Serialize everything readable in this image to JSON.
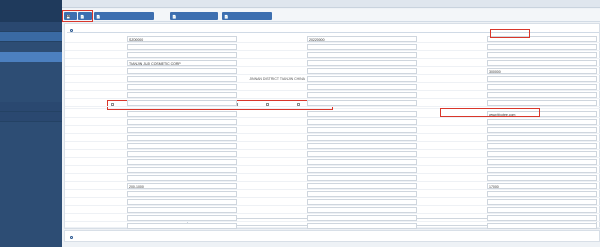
{
  "sidebar": {
    "brand": "",
    "groups": [
      {
        "label": "",
        "open": false
      },
      {
        "label": "",
        "open": true
      }
    ],
    "items": [
      {
        "label": ""
      },
      {
        "label": "",
        "active": true
      },
      {
        "label": ""
      },
      {
        "label": ""
      },
      {
        "label": ""
      },
      {
        "label": ""
      }
    ],
    "bottom_groups": [
      {
        "label": ""
      },
      {
        "label": ""
      }
    ]
  },
  "topbar": {
    "left": "",
    "right": ""
  },
  "toolbar": {
    "buttons": [
      {
        "label": ""
      },
      {
        "label": ""
      },
      {
        "label": ""
      },
      {
        "label": ""
      },
      {
        "label": ""
      }
    ]
  },
  "form": {
    "section_title": "",
    "rows": [
      {
        "l1": "",
        "v1": "SZ00000",
        "l2": "",
        "v2": "20220000",
        "l3": "",
        "v3": ""
      },
      {
        "l1": "",
        "v1": "",
        "l2": "",
        "v2": "",
        "l3": "",
        "v3": ""
      },
      {
        "l1": "",
        "v1": "",
        "l2": "",
        "v2": "",
        "l3": "",
        "v3": ""
      },
      {
        "l1": "",
        "v1": "TIANJIN JUJI COSMETIC CORP",
        "l2": "",
        "v2": "",
        "l3": "",
        "v3": ""
      },
      {
        "l1": "",
        "v1": "",
        "l2": "",
        "v2": "",
        "l3": "",
        "v3": "300000"
      },
      {
        "l1": "",
        "v1": "",
        "l2": "JINNAN DISTRICT TIANJIN CHINA",
        "v2": "",
        "l3": "",
        "v3": ""
      },
      {
        "l1": "",
        "v1": "",
        "l2": "",
        "v2": "",
        "l3": "",
        "v3": ""
      },
      {
        "l1": "",
        "v1": "",
        "l2": "",
        "v2": "",
        "l3": "",
        "v3": ""
      },
      {
        "l1": "",
        "v1": "",
        "l2": "",
        "v2": "",
        "l3": "",
        "v3": ""
      }
    ],
    "checkbox_row": {
      "label": "",
      "options": [
        "",
        "",
        "",
        "",
        "",
        "",
        ""
      ]
    },
    "rows2": [
      {
        "l1": "",
        "v1": "",
        "l2": "",
        "v2": "",
        "l3": "",
        "v3": "www.tfcotee.com"
      },
      {
        "l1": "",
        "v1": "",
        "l2": "",
        "v2": "",
        "l3": "",
        "v3": ""
      },
      {
        "l1": "",
        "v1": "",
        "l2": "",
        "v2": "",
        "l3": "",
        "v3": ""
      },
      {
        "l1": "",
        "v1": "",
        "l2": "",
        "v2": "",
        "l3": "",
        "v3": ""
      },
      {
        "l1": "",
        "v1": "",
        "l2": "",
        "v2": "",
        "l3": "",
        "v3": ""
      },
      {
        "l1": "",
        "v1": "",
        "l2": "",
        "v2": "",
        "l3": "",
        "v3": ""
      },
      {
        "l1": "",
        "v1": "",
        "l2": "",
        "v2": "",
        "l3": "",
        "v3": ""
      },
      {
        "l1": "",
        "v1": "",
        "l2": "",
        "v2": "",
        "l3": "",
        "v3": ""
      },
      {
        "l1": "",
        "v1": "",
        "l2": "",
        "v2": "",
        "l3": "",
        "v3": ""
      },
      {
        "l1": "",
        "v1": "200-1000",
        "l2": "",
        "v2": "",
        "l3": "",
        "v3": "17000"
      },
      {
        "l1": "",
        "v1": "",
        "l2": "",
        "v2": "",
        "l3": "",
        "v3": ""
      },
      {
        "l1": "",
        "v1": "",
        "l2": "",
        "v2": "",
        "l3": "",
        "v3": ""
      },
      {
        "l1": "",
        "v1": "",
        "l2": "",
        "v2": "",
        "l3": "",
        "v3": ""
      },
      {
        "l1": "",
        "v1": "",
        "l2": "",
        "v2": "",
        "l3": "",
        "v3": ""
      },
      {
        "l1": "",
        "v1": "",
        "l2": "",
        "v2": "",
        "l3": "",
        "v3": ""
      },
      {
        "l1": "",
        "v1": "",
        "l2": "",
        "v2": "",
        "l3": "",
        "v3": ""
      }
    ],
    "intro_label": "",
    "intro_text": ""
  },
  "footer": {
    "section_title": ""
  },
  "colors": {
    "sidebar": "#2d4d74",
    "accent": "#3d6fb0",
    "highlight": "#d9372b"
  }
}
